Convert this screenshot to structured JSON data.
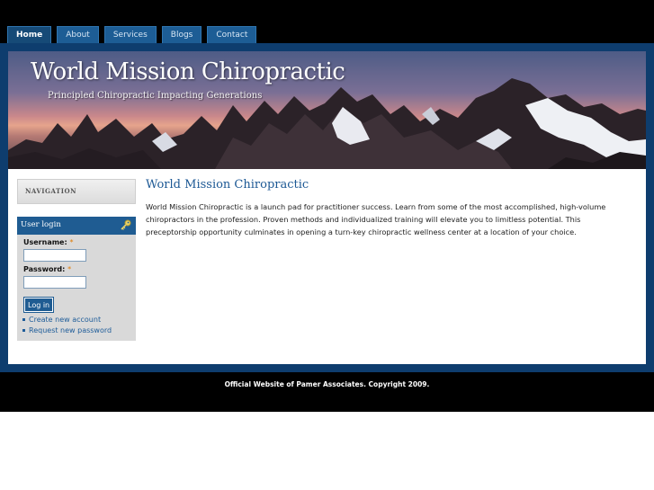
{
  "nav_tabs": [
    {
      "label": "Home",
      "active": true
    },
    {
      "label": "About",
      "active": false
    },
    {
      "label": "Services",
      "active": false
    },
    {
      "label": "Blogs",
      "active": false
    },
    {
      "label": "Contact",
      "active": false
    }
  ],
  "header": {
    "site_name": "World Mission Chiropractic",
    "slogan": "Principled Chiropractic Impacting Generations"
  },
  "sidebar": {
    "navigation_title": "NAVIGATION",
    "login": {
      "title": "User login",
      "username_label": "Username:",
      "password_label": "Password:",
      "required_mark": "*",
      "username_value": "",
      "password_value": "",
      "submit_label": "Log in",
      "links": [
        "Create new account",
        "Request new password"
      ]
    }
  },
  "content": {
    "title": "World Mission Chiropractic",
    "body": "World Mission Chiropractic is a launch pad for practitioner success. Learn from some of the most accomplished, high-volume chiropractors in the profession. Proven methods and individualized training will elevate you to limitless potential. This preceptorship opportunity culminates in opening a turn-key chiropractic wellness center at a location of your choice."
  },
  "footer": {
    "text": "Official Website of Pamer Associates. Copyright 2009."
  },
  "colors": {
    "frame": "#0e3d6e",
    "tab": "#1d5d95",
    "title_link": "#1c5894",
    "required": "#e07a00"
  },
  "icons": [
    "key-icon",
    "bullet-icon"
  ]
}
